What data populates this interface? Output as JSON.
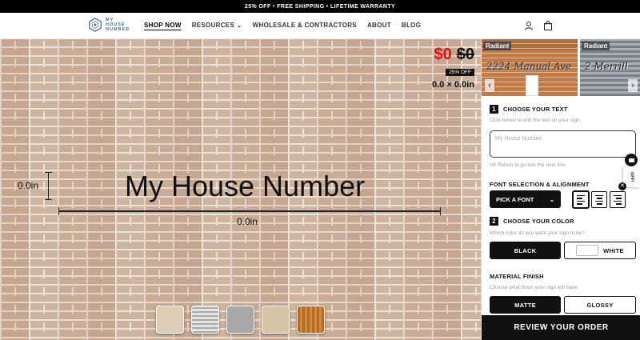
{
  "announcement": "25% OFF • FREE SHIPPING • LIFETIME WARRANTY",
  "logo": {
    "line1": "MY",
    "line2": "HOUSE",
    "line3": "NUMBER"
  },
  "nav": {
    "items": [
      "SHOP NOW",
      "RESOURCES",
      "WHOLESALE & CONTRACTORS",
      "ABOUT",
      "BLOG"
    ],
    "active": "SHOP NOW"
  },
  "icons": {
    "account": "user-icon",
    "cart": "bag-icon"
  },
  "preview": {
    "sign_text": "My House Number",
    "height_label": "0.0in",
    "width_label": "0.0in",
    "price_new": "$0",
    "price_old": "$0",
    "discount_badge": "25% OFF",
    "size": "0.0 × 0.0in"
  },
  "material_swatches": [
    "sandstone",
    "corrugated-gray",
    "concrete-gray",
    "stucco-beige",
    "wood"
  ],
  "thumbnails": [
    {
      "tag": "Radiant",
      "text": "2224 Manual Ave"
    },
    {
      "tag": "Radiant",
      "text": "2 Merrill"
    }
  ],
  "steps": {
    "choose_text": {
      "num": "1",
      "title": "CHOOSE YOUR TEXT",
      "help": "Click below to edit the text on your sign",
      "placeholder": "My House Number",
      "hint": "Hit Return to go into the next line."
    },
    "font": {
      "title": "FONT SELECTION & ALIGNMENT",
      "button": "PICK A FONT"
    },
    "color": {
      "num": "2",
      "title": "CHOOSE YOUR COLOR",
      "help": "Which color do you want your sign to be?",
      "options": [
        "BLACK",
        "WHITE"
      ],
      "selected": "BLACK"
    },
    "finish": {
      "title": "MATERIAL FINISH",
      "help": "Choose what finish your sign will have",
      "options": [
        "MATTE",
        "GLOSSY"
      ],
      "selected": "MATTE"
    }
  },
  "review_button": "REVIEW YOUR ORDER",
  "promo_tab": "OFF!",
  "colors": {
    "accent": "#111111",
    "price_red": "#e01010"
  }
}
